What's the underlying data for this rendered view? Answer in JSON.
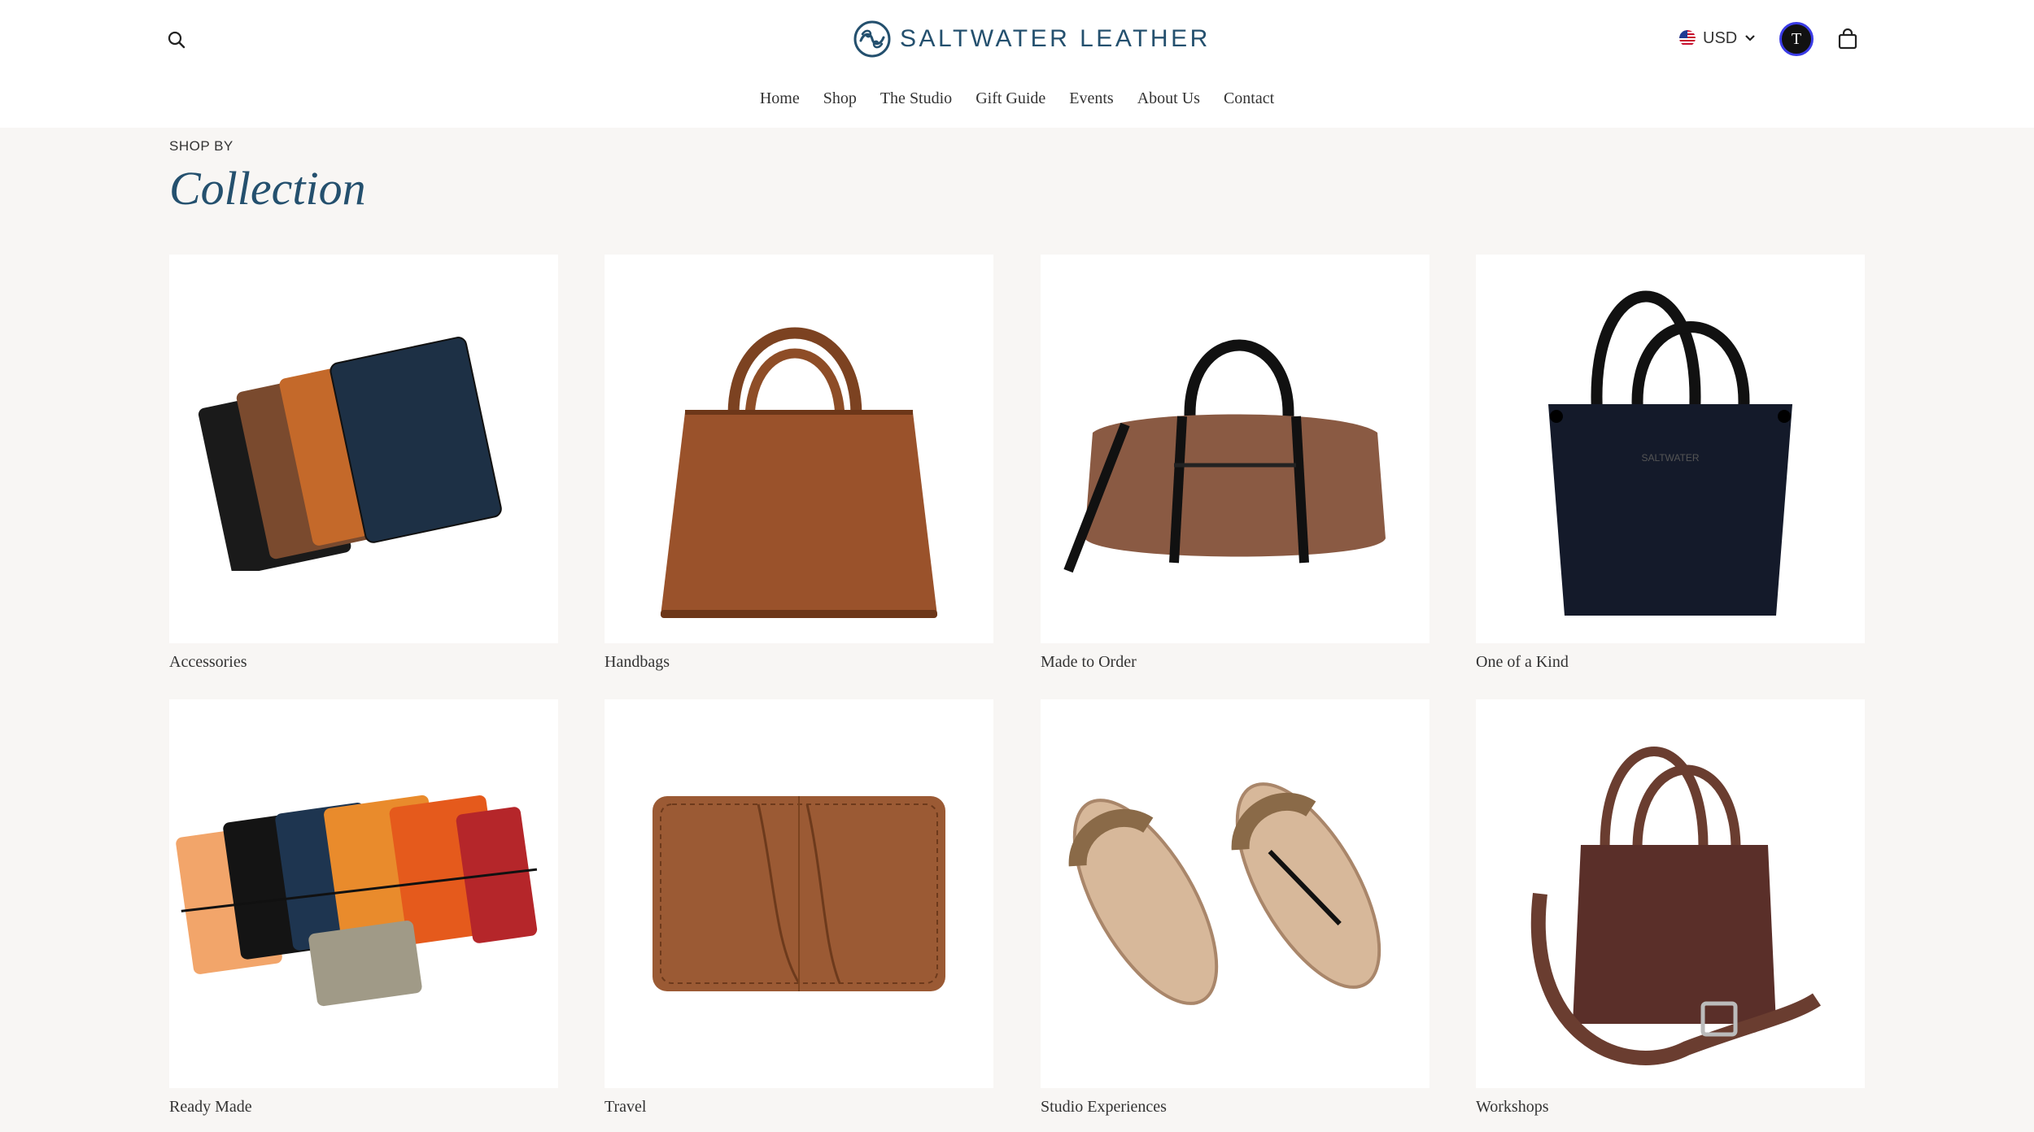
{
  "brand": {
    "name": "SALTWATER LEATHER",
    "accent": "#24506e"
  },
  "header": {
    "currency": "USD",
    "avatar_initial": "T"
  },
  "nav": [
    "Home",
    "Shop",
    "The Studio",
    "Gift Guide",
    "Events",
    "About Us",
    "Contact"
  ],
  "section": {
    "eyebrow": "SHOP BY",
    "title": "Collection"
  },
  "collections": [
    {
      "label": "Accessories",
      "icon": "card-wallets-image"
    },
    {
      "label": "Handbags",
      "icon": "handbag-image"
    },
    {
      "label": "Made to Order",
      "icon": "duffel-bag-image"
    },
    {
      "label": "One of a Kind",
      "icon": "tote-bag-image"
    },
    {
      "label": "Ready Made",
      "icon": "notebook-covers-image"
    },
    {
      "label": "Travel",
      "icon": "passport-wallet-image"
    },
    {
      "label": "Studio Experiences",
      "icon": "sandals-image"
    },
    {
      "label": "Workshops",
      "icon": "crossbody-bag-image"
    }
  ]
}
